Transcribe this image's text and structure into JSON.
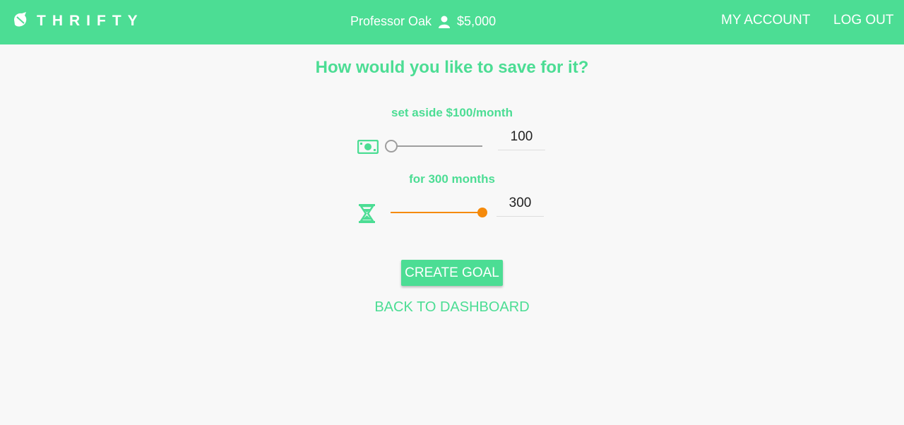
{
  "header": {
    "brand": "THRIFTY",
    "user_name": "Professor Oak",
    "balance": "$5,000",
    "nav": {
      "my_account": "MY ACCOUNT",
      "log_out": "LOG OUT"
    }
  },
  "form": {
    "title": "How would you like to save for it?",
    "amount": {
      "label": "set aside $100/month",
      "value": "100",
      "slider_fraction": 0.0,
      "icon": "cash-icon"
    },
    "duration": {
      "label": "for 300 months",
      "value": "300",
      "slider_fraction": 1.0,
      "icon": "hourglass-icon"
    },
    "create_label": "CREATE GOAL",
    "back_label": "BACK TO DASHBOARD"
  },
  "colors": {
    "brand_green": "#4cdd94",
    "slider_orange": "#f58a0b",
    "slider_grey": "#9e9e9e"
  }
}
